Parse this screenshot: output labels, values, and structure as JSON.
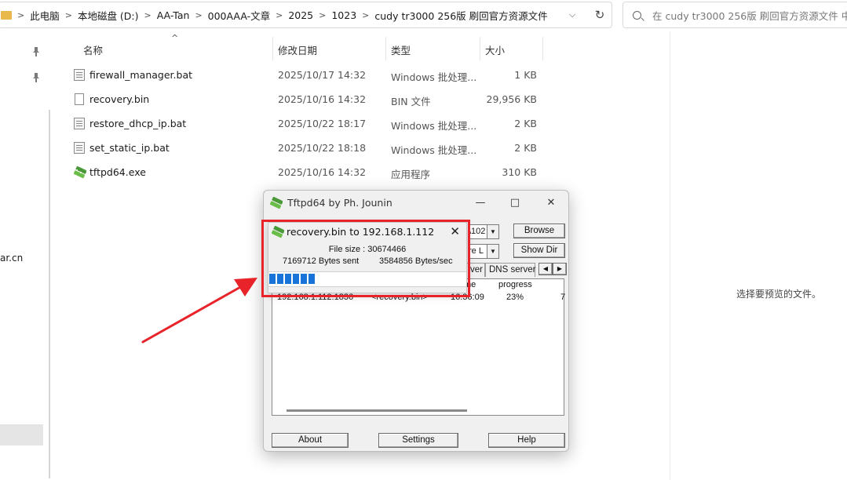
{
  "address": {
    "crumbs": [
      "此电脑",
      "本地磁盘 (D:)",
      "AA-Tan",
      "000AAA-文章",
      "2025",
      "1023",
      "cudy tr3000 256版 刷回官方资源文件"
    ],
    "dropdown_glyph": "⌵",
    "refresh_glyph": "↻"
  },
  "search": {
    "placeholder": "在 cudy tr3000 256版 刷回官方资源文件 中搜索"
  },
  "nav": {
    "cut_text": "ar.cn"
  },
  "columns": {
    "name": "名称",
    "date": "修改日期",
    "type": "类型",
    "size": "大小"
  },
  "files": [
    {
      "name": "firewall_manager.bat",
      "date": "2025/10/17 14:32",
      "type": "Windows 批处理...",
      "size": "1 KB",
      "icon": "bat-file-icon"
    },
    {
      "name": "recovery.bin",
      "date": "2025/10/16 14:32",
      "type": "BIN 文件",
      "size": "29,956 KB",
      "icon": "bin-file-icon"
    },
    {
      "name": "restore_dhcp_ip.bat",
      "date": "2025/10/22 18:17",
      "type": "Windows 批处理...",
      "size": "2 KB",
      "icon": "bat-file-icon"
    },
    {
      "name": "set_static_ip.bat",
      "date": "2025/10/22 18:18",
      "type": "Windows 批处理...",
      "size": "2 KB",
      "icon": "bat-file-icon"
    },
    {
      "name": "tftpd64.exe",
      "date": "2025/10/16 14:32",
      "type": "应用程序",
      "size": "310 KB",
      "icon": "tftpd-app-icon"
    }
  ],
  "preview": {
    "message": "选择要预览的文件。"
  },
  "tftpd": {
    "title": "Tftpd64 by Ph. Jounin",
    "combo_dir_fragment": "\\102",
    "combo_if_fragment": "re L",
    "browse_label": "Browse",
    "showdir_label": "Show Dir",
    "tab_fragment": "ver",
    "tab_dns": "DNS server",
    "list_headers": {
      "col3_fragment": "me",
      "progress": "progress"
    },
    "list_row": {
      "peer": "192.168.1.112:1836",
      "file": "<recovery.bin>",
      "time": "16:36:09",
      "progress": "23%",
      "extra": "7"
    },
    "about_label": "About",
    "settings_label": "Settings",
    "help_label": "Help"
  },
  "transfer": {
    "title": "recovery.bin to 192.168.1.112",
    "file_size": "File size : 30674466",
    "bytes_sent": "7169712 Bytes sent",
    "rate": "3584856 Bytes/sec",
    "progress_fraction": 0.23
  },
  "colors": {
    "highlight_box": "#e8232a",
    "arrow": "#e8232a",
    "progress": "#1874d8"
  }
}
